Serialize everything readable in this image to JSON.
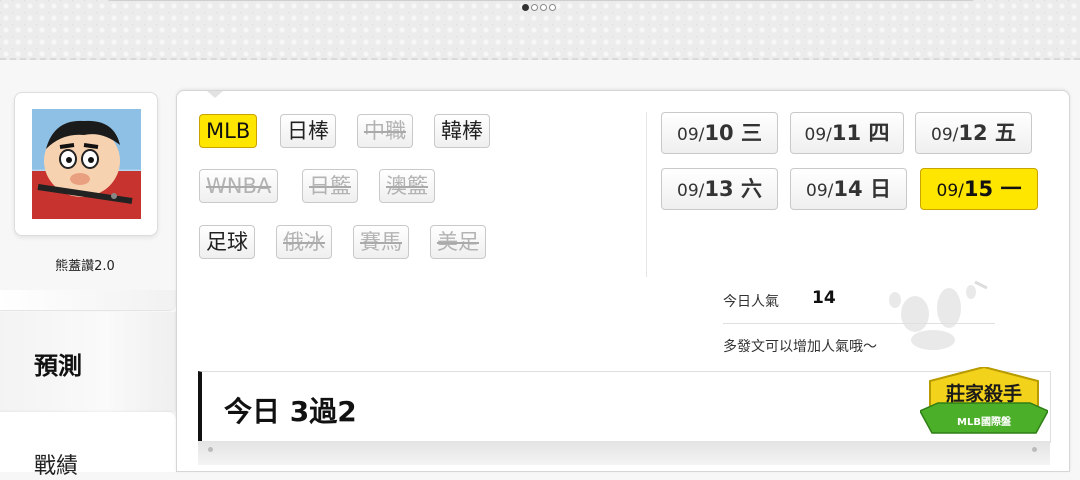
{
  "profile": {
    "nickname": "熊蓋讚2.0"
  },
  "nav": {
    "predict": "預測",
    "record": "戰績"
  },
  "leagues": [
    {
      "label": "MLB",
      "state": "active"
    },
    {
      "label": "日棒",
      "state": "normal"
    },
    {
      "label": "中職",
      "state": "disabled"
    },
    {
      "label": "韓棒",
      "state": "normal"
    },
    {
      "label": "WNBA",
      "state": "disabled"
    },
    {
      "label": "日籃",
      "state": "disabled"
    },
    {
      "label": "澳籃",
      "state": "disabled"
    },
    {
      "label": "足球",
      "state": "normal"
    },
    {
      "label": "俄冰",
      "state": "disabled"
    },
    {
      "label": "賽馬",
      "state": "disabled"
    },
    {
      "label": "美足",
      "state": "disabled"
    }
  ],
  "dates": [
    {
      "md": "09/",
      "d": "10 三",
      "state": "normal"
    },
    {
      "md": "09/",
      "d": "11 四",
      "state": "normal"
    },
    {
      "md": "09/",
      "d": "12 五",
      "state": "normal"
    },
    {
      "md": "09/",
      "d": "13 六",
      "state": "normal"
    },
    {
      "md": "09/",
      "d": "14 日",
      "state": "normal"
    },
    {
      "md": "09/",
      "d": "15 一",
      "state": "active"
    }
  ],
  "popularity": {
    "label": "今日人氣",
    "value": "14",
    "hint": "多發文可以增加人氣哦～"
  },
  "today": {
    "label": "今日 3過2"
  },
  "badge": {
    "title": "莊家殺手",
    "subtitle": "MLB國際盤"
  },
  "colors": {
    "active": "#ffe600",
    "badge_green": "#4caf2a",
    "badge_yellow": "#f2d21a"
  }
}
